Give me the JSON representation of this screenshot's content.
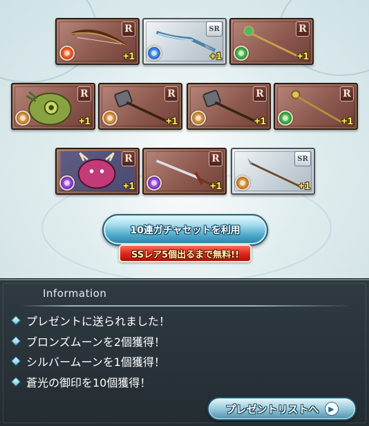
{
  "cards": [
    {
      "name": "bow",
      "rarity": "R",
      "element": "fire",
      "plus": "+1"
    },
    {
      "name": "spear",
      "rarity": "SR",
      "element": "water",
      "plus": "+1"
    },
    {
      "name": "staff-green",
      "rarity": "R",
      "element": "wind",
      "plus": "+1"
    },
    {
      "name": "golem",
      "rarity": "R",
      "element": "earth",
      "plus": "+1"
    },
    {
      "name": "hammer-1",
      "rarity": "R",
      "element": "earth",
      "plus": "+1"
    },
    {
      "name": "hammer-2",
      "rarity": "R",
      "element": "earth",
      "plus": "+1"
    },
    {
      "name": "staff-gold",
      "rarity": "R",
      "element": "wind",
      "plus": "+1"
    },
    {
      "name": "demon",
      "rarity": "R",
      "element": "dark",
      "plus": "+1"
    },
    {
      "name": "sword",
      "rarity": "R",
      "element": "dark",
      "plus": "+1"
    },
    {
      "name": "lance",
      "rarity": "SR",
      "element": "earth",
      "plus": "+1"
    }
  ],
  "gacha": {
    "button_label": "10連ガチャセットを利用",
    "ribbon_label": "SSレア5個出るまで無料!!"
  },
  "info": {
    "title": "Information",
    "lines": [
      "プレゼントに送られました！",
      "ブロンズムーンを2個獲得！",
      "シルバームーンを1個獲得！",
      "蒼光の御印を10個獲得！"
    ],
    "present_button": "プレゼントリストへ"
  },
  "colors": {
    "rarity_r": "#8e5a50",
    "rarity_sr": "#c8d3da",
    "panel": "#2f3a41",
    "plus": "#fff45a"
  }
}
